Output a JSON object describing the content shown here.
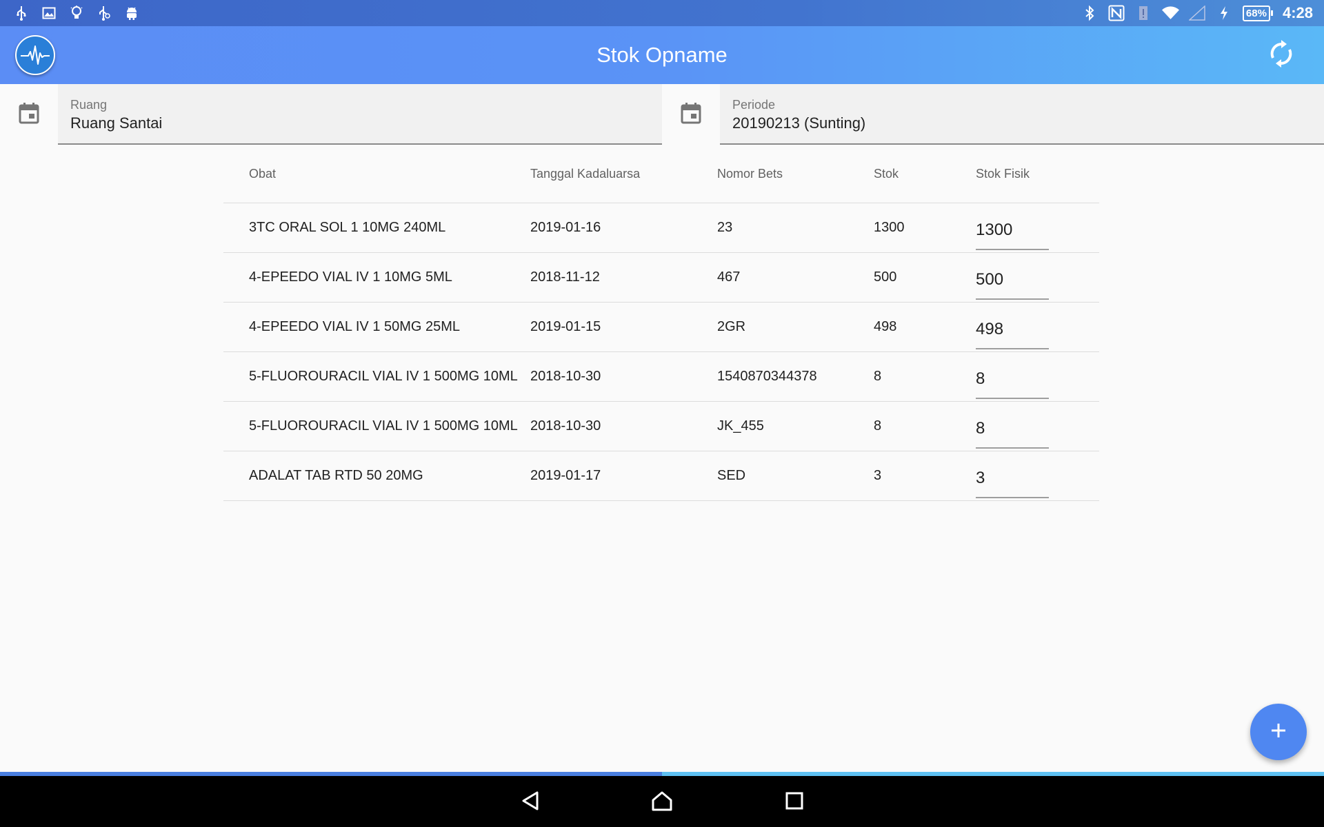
{
  "status_bar": {
    "left_icons": [
      "usb-icon",
      "image-icon",
      "bulb-icon",
      "usb-debug-icon",
      "android-icon"
    ],
    "right_icons": [
      "bluetooth-icon",
      "nfc-icon",
      "alert-icon",
      "wifi-icon",
      "signal-icon",
      "charging-icon"
    ],
    "battery": "68%",
    "time": "4:28"
  },
  "app_bar": {
    "logo": "heartbeat-logo",
    "title": "Stok Opname",
    "action_icon": "sync-icon"
  },
  "filters": {
    "ruang": {
      "label": "Ruang",
      "value": "Ruang Santai",
      "icon": "calendar-icon"
    },
    "periode": {
      "label": "Periode",
      "value": "20190213 (Sunting)",
      "icon": "calendar-icon"
    }
  },
  "table": {
    "headers": [
      "Obat",
      "Tanggal Kadaluarsa",
      "Nomor Bets",
      "Stok",
      "Stok Fisik"
    ],
    "rows": [
      [
        "3TC ORAL SOL 1 10MG 240ML",
        "2019-01-16",
        "23",
        "1300",
        "1300"
      ],
      [
        "4-EPEEDO VIAL IV 1 10MG 5ML",
        "2018-11-12",
        "467",
        "500",
        "500"
      ],
      [
        "4-EPEEDO VIAL IV 1 50MG 25ML",
        "2019-01-15",
        "2GR",
        "498",
        "498"
      ],
      [
        "5-FLUOROURACIL VIAL IV 1 500MG 10ML",
        "2018-10-30",
        "1540870344378",
        "8",
        "8"
      ],
      [
        "5-FLUOROURACIL VIAL IV 1 500MG 10ML",
        "2018-10-30",
        "JK_455",
        "8",
        "8"
      ],
      [
        "ADALAT TAB RTD 50 20MG",
        "2019-01-17",
        "SED",
        "3",
        "3"
      ]
    ]
  },
  "fab": {
    "icon": "plus-icon"
  },
  "progress": {
    "fraction": 0.5
  },
  "nav_bar": {
    "icons": [
      "back-icon",
      "home-icon",
      "recents-icon"
    ]
  },
  "colors": {
    "app_bar_start": "#5b8df5",
    "app_bar_end": "#5ab8f7",
    "fab": "#4f87f1",
    "status_bar": "#3d66c8"
  }
}
